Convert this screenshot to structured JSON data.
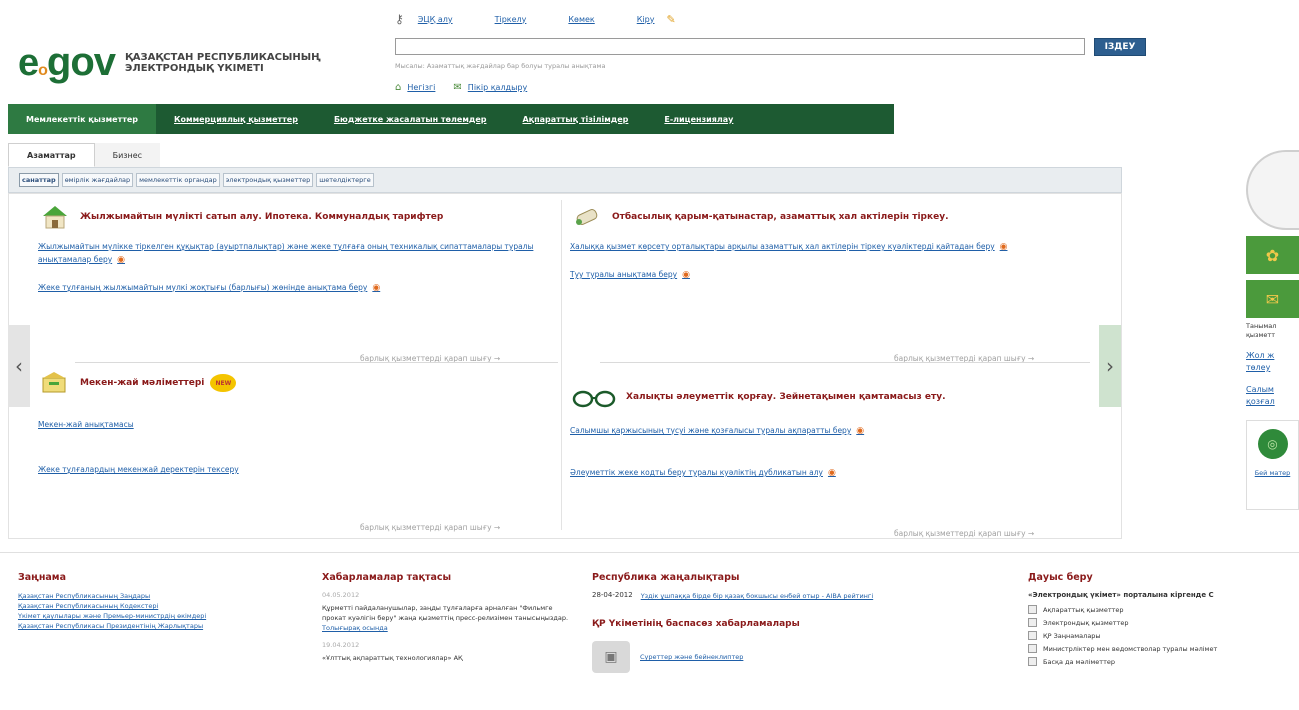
{
  "header": {
    "logo_text": "e",
    "logo_o": "o",
    "logo_gov": "gov",
    "logo_tagline_1": "ҚАЗАҚСТАН РЕСПУБЛИКАСЫНЫҢ",
    "logo_tagline_2": "ЭЛЕКТРОНДЫҚ ҮКІМЕТІ",
    "top_links": [
      "ЭЦҚ алу",
      "Тіркелу",
      "Көмек",
      "Кіру"
    ],
    "search_placeholder": "",
    "search_button": "ІЗДЕУ",
    "search_hint": "Мысалы: Азаматтық жағдайлар бар болуы туралы анықтама",
    "home_links": [
      "Негізгі",
      "Пікір қалдыру"
    ]
  },
  "main_nav": {
    "tabs": [
      "Мемлекеттік қызметтер",
      "Коммерциялық қызметтер",
      "Бюджетке жасалатын төлемдер",
      "Ақпараттық тізілімдер",
      "E-лицензиялау"
    ]
  },
  "sub_tabs": [
    "Азаматтар",
    "Бизнес"
  ],
  "filters": [
    "санаттар",
    "өмірлік жағдайлар",
    "мемлекеттік органдар",
    "электрондық қызметтер",
    "шетелдіктерге"
  ],
  "sections": {
    "realty": {
      "title": "Жылжымайтын мүлікті сатып алу. Ипотека. Коммуналдық тарифтер",
      "items": [
        "Жылжымайтын мүлікке тіркелген құқықтар (ауыртпалықтар) және жеке тұлғаға оның техникалық сипаттамалары туралы анықтамалар беру",
        "Жеке тұлғаның жылжымайтын мүлкі жоқтығы (барлығы) жөнінде анықтама беру"
      ],
      "more": "барлық қызметтерді қарап шығу →"
    },
    "family": {
      "title": "Отбасылық қарым-қатынастар, азаматтық хал актілерін тіркеу.",
      "items": [
        "Халыққа қызмет көрсету орталықтары арқылы азаматтық хал актілерін тіркеу куәліктерді қайтадан беру",
        "Туу туралы анықтама беру"
      ],
      "more": "барлық қызметтерді қарап шығу →"
    },
    "address": {
      "title": "Мекен-жай мәліметтері",
      "badge": "NEW",
      "items": [
        "Мекен-жай анықтамасы",
        "Жеке тұлғалардың мекенжай деректерін тексеру"
      ],
      "more": "барлық қызметтерді қарап шығу →"
    },
    "social": {
      "title": "Халықты әлеуметтік қорғау. Зейнетақымен қамтамасыз ету.",
      "items": [
        "Салымшы қаржысының түсуі және қозғалысы туралы ақпаратты беру",
        "Әлеуметтік жеке кодты беру туралы куәліктің дубликатын алу"
      ],
      "more": "барлық қызметтерді қарап шығу →"
    }
  },
  "right_rail": {
    "label": "Танымал қызметт",
    "links": [
      "Жол ж төлеу",
      "Салым қозғал"
    ],
    "media": "Бей матер"
  },
  "footer": {
    "legal": {
      "title": "Заңнама",
      "links": [
        "Қазақстан Республикасының Заңдары",
        "Қазақстан Республикасының Кодекстері",
        "Үкімет қаулылары және Премьер-министрдің өкімдері",
        "Қазақстан Республикасы Президентінің Жарлықтары"
      ]
    },
    "board": {
      "title": "Хабарламалар тақтасы",
      "date1": "04.05.2012",
      "text1": "Құрметті пайдаланушылар, заңды тұлғаларға арналған \"Фильмге прокат куәлігін беру\" жаңа қызметтің пресс-релизімен танысыңыздар.",
      "link1": "Толығырақ осында",
      "date2": "19.04.2012",
      "text2": "«Ұлттық ақпараттық технологиялар» АҚ"
    },
    "news": {
      "title": "Республика жаңалықтары",
      "date": "28-04-2012",
      "headline": "Үздік ұшпаққа бірде бір қазақ бокшысы енбей отыр - AIBA рейтингі",
      "press_title": "ҚР Үкіметінің баспасөз хабарламалары",
      "video": "Суреттер және бейнеклиптер"
    },
    "poll": {
      "title": "Дауыс беру",
      "question": "«Электрондық үкімет» порталына кіргенде С",
      "options": [
        "Ақпараттық қызметтер",
        "Электрондық қызметтер",
        "ҚР Заңнамалары",
        "Министрліктер мен ведомстволар туралы мәлімет",
        "Басқа да мәліметтер"
      ]
    }
  }
}
